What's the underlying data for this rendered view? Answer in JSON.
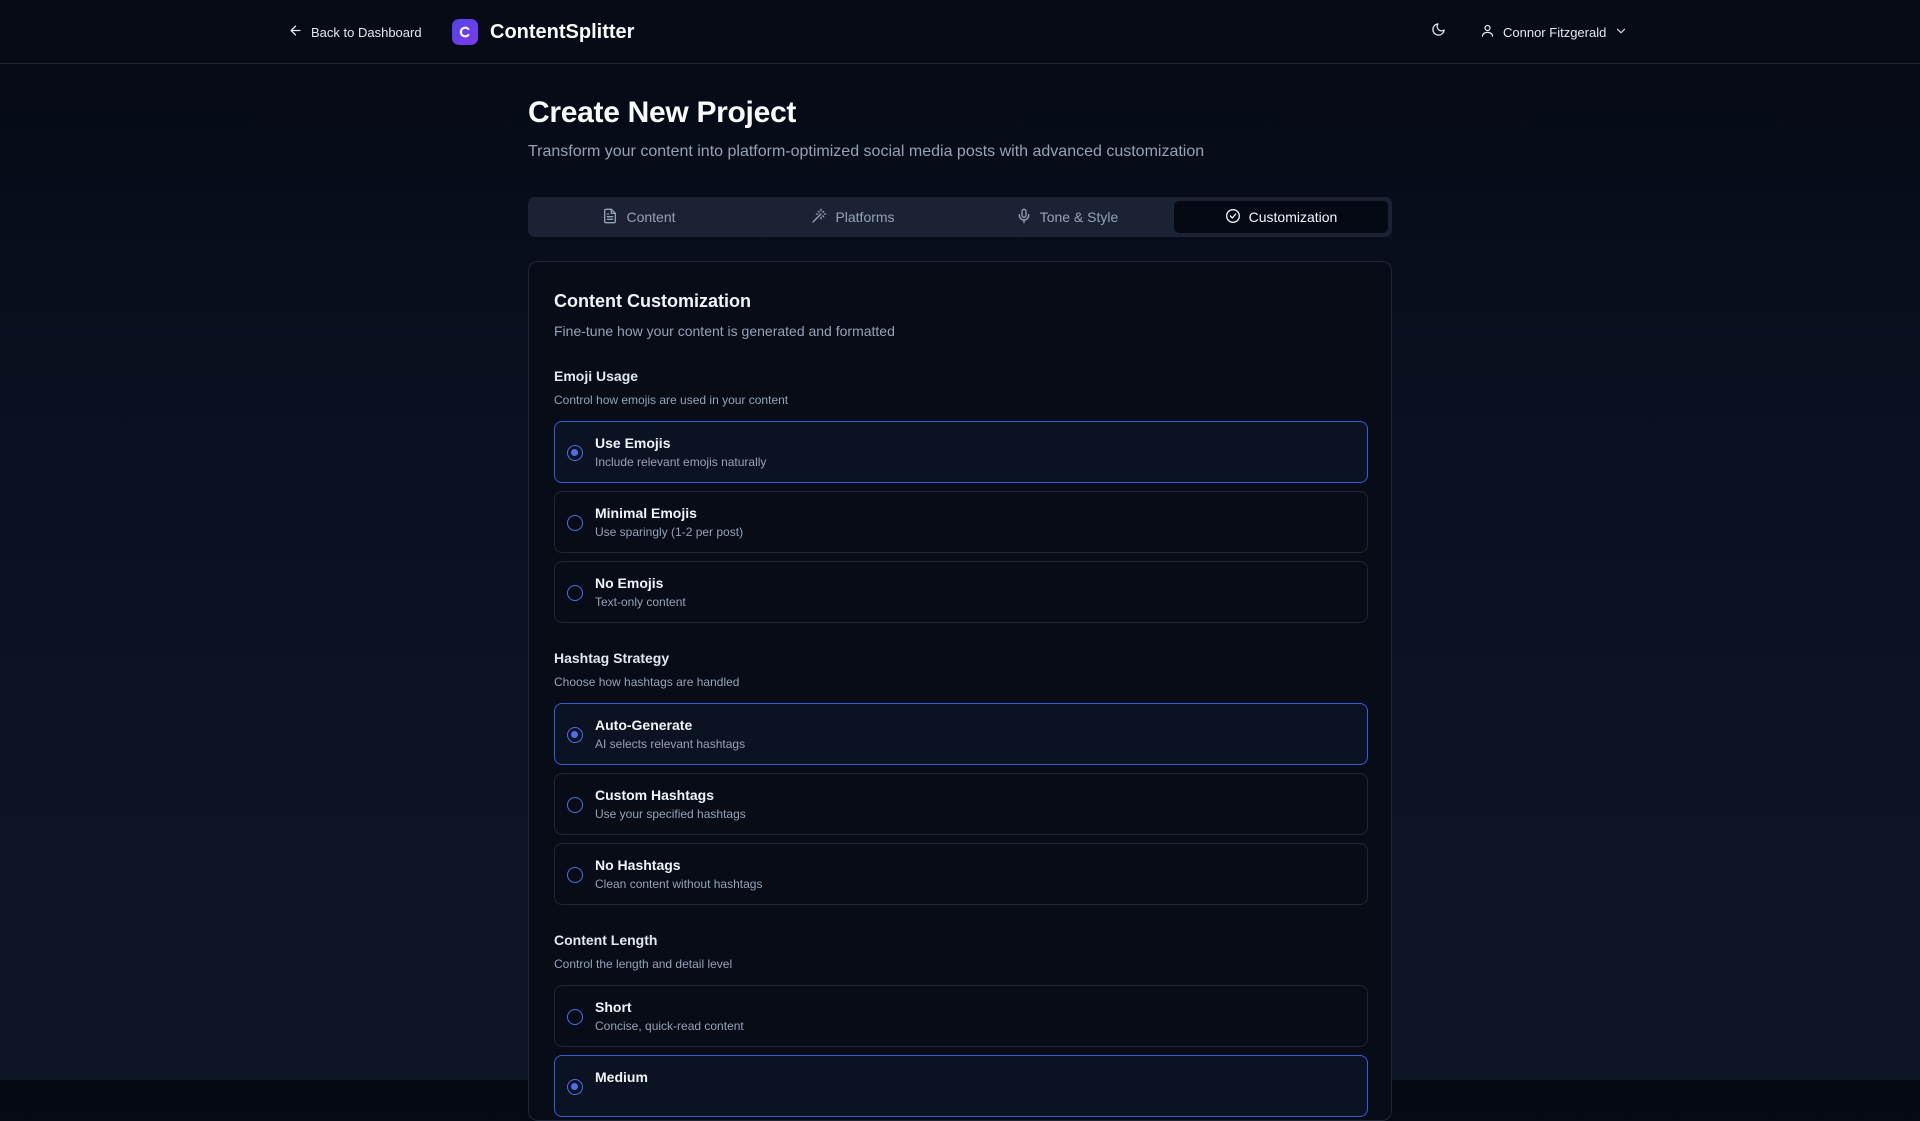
{
  "header": {
    "back_label": "Back to Dashboard",
    "brand_name": "ContentSplitter",
    "user_name": "Connor Fitzgerald"
  },
  "page": {
    "title": "Create New Project",
    "subtitle": "Transform your content into platform-optimized social media posts with advanced customization"
  },
  "tabs": [
    {
      "label": "Content",
      "icon": "document-icon",
      "active": false
    },
    {
      "label": "Platforms",
      "icon": "wand-icon",
      "active": false
    },
    {
      "label": "Tone & Style",
      "icon": "mic-icon",
      "active": false
    },
    {
      "label": "Customization",
      "icon": "check-circle-icon",
      "active": true
    }
  ],
  "card": {
    "title": "Content Customization",
    "description": "Fine-tune how your content is generated and formatted"
  },
  "sections": [
    {
      "label": "Emoji Usage",
      "help": "Control how emojis are used in your content",
      "options": [
        {
          "label": "Use Emojis",
          "sub": "Include relevant emojis naturally",
          "selected": true
        },
        {
          "label": "Minimal Emojis",
          "sub": "Use sparingly (1-2 per post)",
          "selected": false
        },
        {
          "label": "No Emojis",
          "sub": "Text-only content",
          "selected": false
        }
      ]
    },
    {
      "label": "Hashtag Strategy",
      "help": "Choose how hashtags are handled",
      "options": [
        {
          "label": "Auto-Generate",
          "sub": "AI selects relevant hashtags",
          "selected": true
        },
        {
          "label": "Custom Hashtags",
          "sub": "Use your specified hashtags",
          "selected": false
        },
        {
          "label": "No Hashtags",
          "sub": "Clean content without hashtags",
          "selected": false
        }
      ]
    },
    {
      "label": "Content Length",
      "help": "Control the length and detail level",
      "options": [
        {
          "label": "Short",
          "sub": "Concise, quick-read content",
          "selected": false
        },
        {
          "label": "Medium",
          "sub": "",
          "selected": true
        }
      ]
    }
  ],
  "colors": {
    "accent": "#4f6fe8",
    "background": "#0b1120",
    "brand": "#4f46e5"
  }
}
